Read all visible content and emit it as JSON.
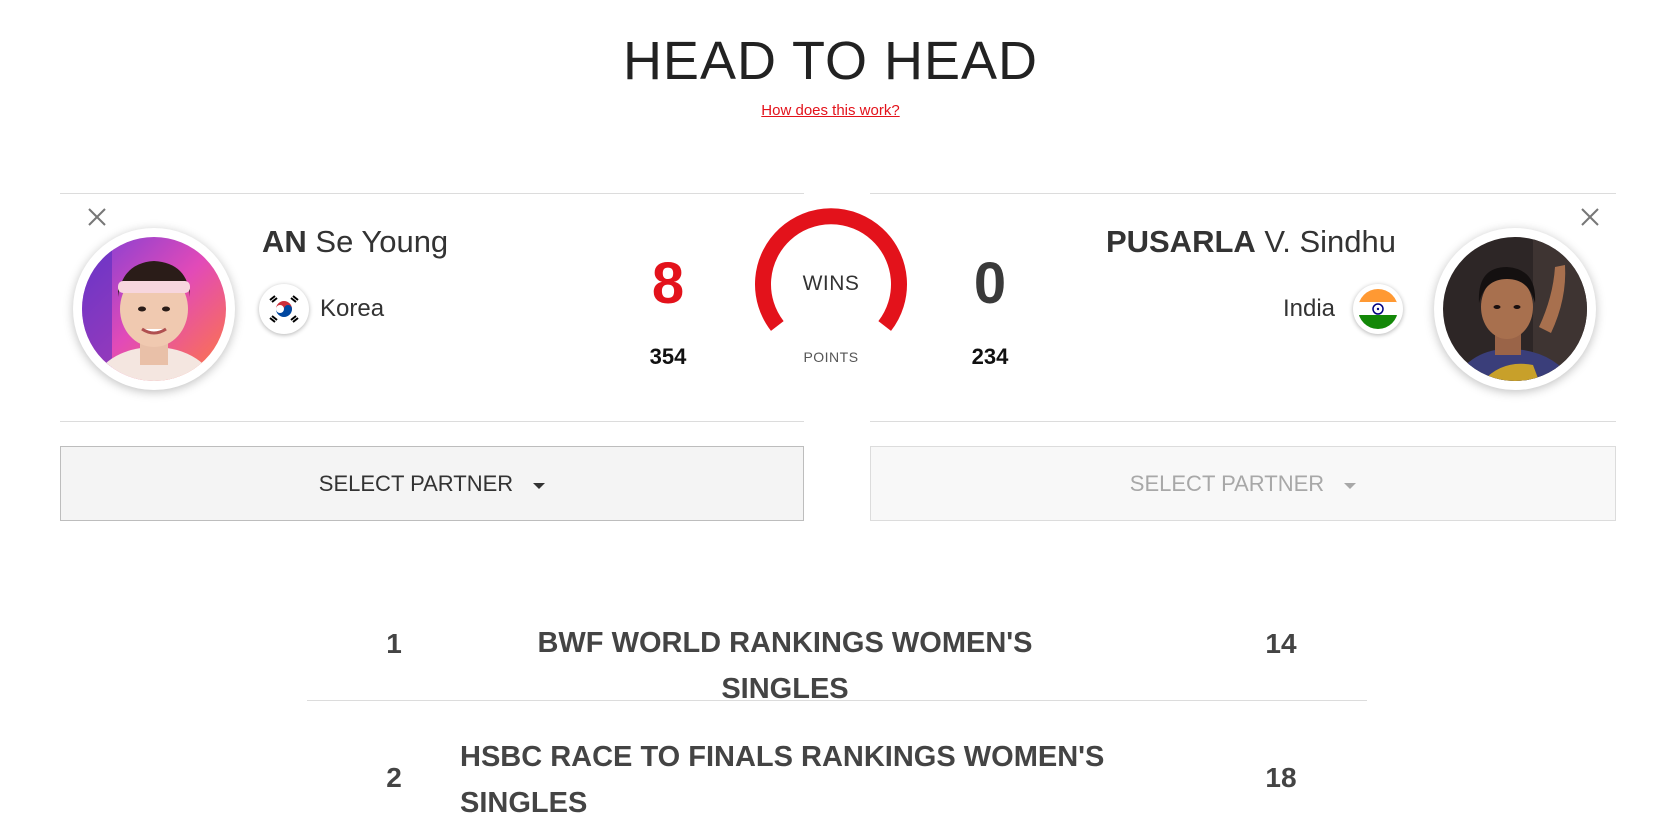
{
  "header": {
    "title": "HEAD TO HEAD",
    "how_link": "How does this work?"
  },
  "player1": {
    "surname": "AN",
    "given": "Se Young",
    "country": "Korea",
    "wins": "8",
    "points": "354",
    "wins_color": "#e3121b",
    "select_partner": "SELECT PARTNER"
  },
  "player2": {
    "surname": "PUSARLA",
    "given": "V. Sindhu",
    "country": "India",
    "wins": "0",
    "points": "234",
    "wins_color": "#3a3a3a",
    "select_partner": "SELECT PARTNER"
  },
  "gauge": {
    "wins_label": "WINS",
    "points_label": "POINTS",
    "color": "#e3121b"
  },
  "rankings": [
    {
      "p1_rank": "1",
      "name_line1": "BWF WORLD RANKINGS WOMEN'S SINGLES",
      "name_line2": "",
      "p2_rank": "14"
    },
    {
      "p1_rank": "2",
      "name_line1": "HSBC RACE TO FINALS RANKINGS WOMEN'S",
      "name_line2": "SINGLES",
      "p2_rank": "18"
    }
  ],
  "icons": {
    "close": "close-icon",
    "caret": "caret-down-icon"
  }
}
